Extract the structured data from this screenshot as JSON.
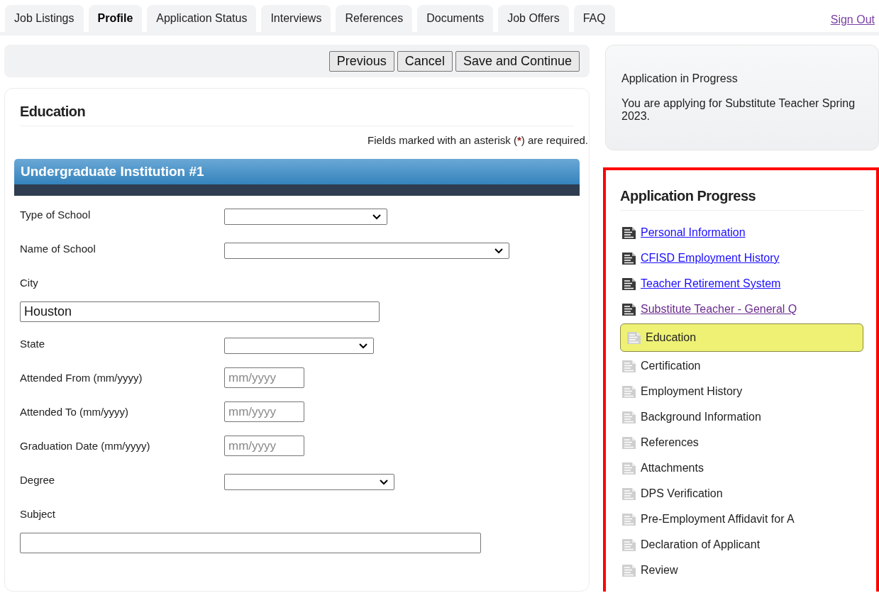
{
  "tabs": [
    {
      "label": "Job Listings",
      "selected": false
    },
    {
      "label": "Profile",
      "selected": true
    },
    {
      "label": "Application Status",
      "selected": false
    },
    {
      "label": "Interviews",
      "selected": false
    },
    {
      "label": "References",
      "selected": false
    },
    {
      "label": "Documents",
      "selected": false
    },
    {
      "label": "Job Offers",
      "selected": false
    },
    {
      "label": "FAQ",
      "selected": false
    }
  ],
  "sign_out": "Sign Out",
  "toolbar": {
    "buttons": [
      "Previous",
      "Cancel",
      "Save and Continue"
    ]
  },
  "form": {
    "title": "Education",
    "required_note": {
      "before": "Fields marked with an asterisk (",
      "mark": "*",
      "after": ") are required."
    },
    "section": {
      "title": "Undergraduate Institution #1"
    },
    "fields": [
      {
        "label": "Type of School",
        "kind": "select"
      },
      {
        "label": "Name of School",
        "kind": "select"
      },
      {
        "label": "City",
        "kind": "text",
        "value": "Houston"
      },
      {
        "label": "State",
        "kind": "select"
      },
      {
        "label": "Attended From (mm/yyyy)",
        "kind": "date",
        "placeholder": "mm/yyyy"
      },
      {
        "label": "Attended To (mm/yyyy)",
        "kind": "date",
        "placeholder": "mm/yyyy"
      },
      {
        "label": "Graduation Date (mm/yyyy)",
        "kind": "date",
        "placeholder": "mm/yyyy"
      },
      {
        "label": "Degree",
        "kind": "select"
      },
      {
        "label": "Subject",
        "kind": "text"
      }
    ]
  },
  "info": {
    "title": "Application in Progress",
    "text": "You are applying for Substitute Teacher Spring 2023."
  },
  "progress": {
    "title": "Application Progress",
    "items": [
      {
        "label": "Personal Information",
        "kind": "link",
        "visited": false,
        "selected": false
      },
      {
        "label": "CFISD Employment History",
        "kind": "link",
        "visited": false,
        "selected": false
      },
      {
        "label": "Teacher Retirement System",
        "kind": "link",
        "visited": false,
        "selected": false
      },
      {
        "label": "Substitute Teacher - General Q",
        "kind": "link",
        "visited": true,
        "selected": false
      },
      {
        "label": "Education",
        "kind": "plain",
        "selected": true
      },
      {
        "label": "Certification",
        "kind": "plain",
        "selected": false
      },
      {
        "label": "Employment History",
        "kind": "plain",
        "selected": false
      },
      {
        "label": "Background Information",
        "kind": "plain",
        "selected": false
      },
      {
        "label": "References",
        "kind": "plain",
        "selected": false
      },
      {
        "label": "Attachments",
        "kind": "plain",
        "selected": false
      },
      {
        "label": "DPS Verification",
        "kind": "plain",
        "selected": false
      },
      {
        "label": "Pre-Employment Affidavit for A",
        "kind": "plain",
        "selected": false
      },
      {
        "label": "Declaration of Applicant",
        "kind": "plain",
        "selected": false
      },
      {
        "label": "Review",
        "kind": "plain",
        "selected": false
      }
    ]
  }
}
